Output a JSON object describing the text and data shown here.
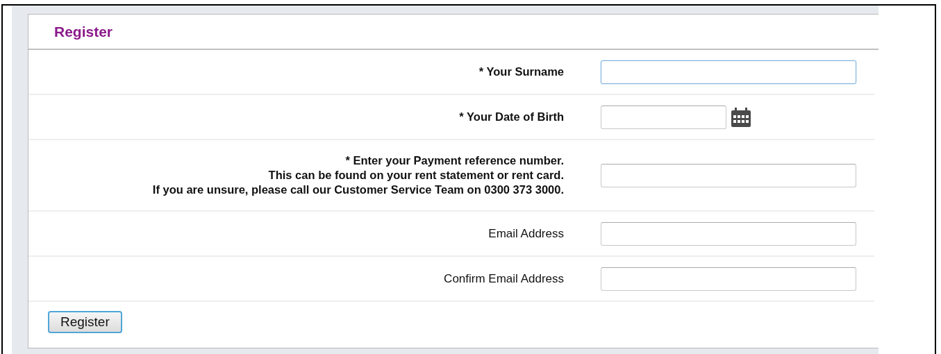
{
  "form": {
    "title": "Register",
    "fields": [
      {
        "kind": "text",
        "label_lines": [
          "* Your Surname"
        ],
        "required": true,
        "focused": true
      },
      {
        "kind": "date",
        "label_lines": [
          "* Your Date of Birth"
        ],
        "required": true,
        "focused": false
      },
      {
        "kind": "text",
        "label_lines": [
          "* Enter your Payment reference number.",
          "This can be found on your rent statement or rent card.",
          "If you are unsure, please call our Customer Service Team on 0300 373 3000."
        ],
        "required": true,
        "focused": false
      },
      {
        "kind": "text",
        "label_lines": [
          "Email Address"
        ],
        "required": false,
        "focused": false
      },
      {
        "kind": "text",
        "label_lines": [
          "Confirm Email Address"
        ],
        "required": false,
        "focused": false
      }
    ],
    "submit_button": "Register"
  }
}
